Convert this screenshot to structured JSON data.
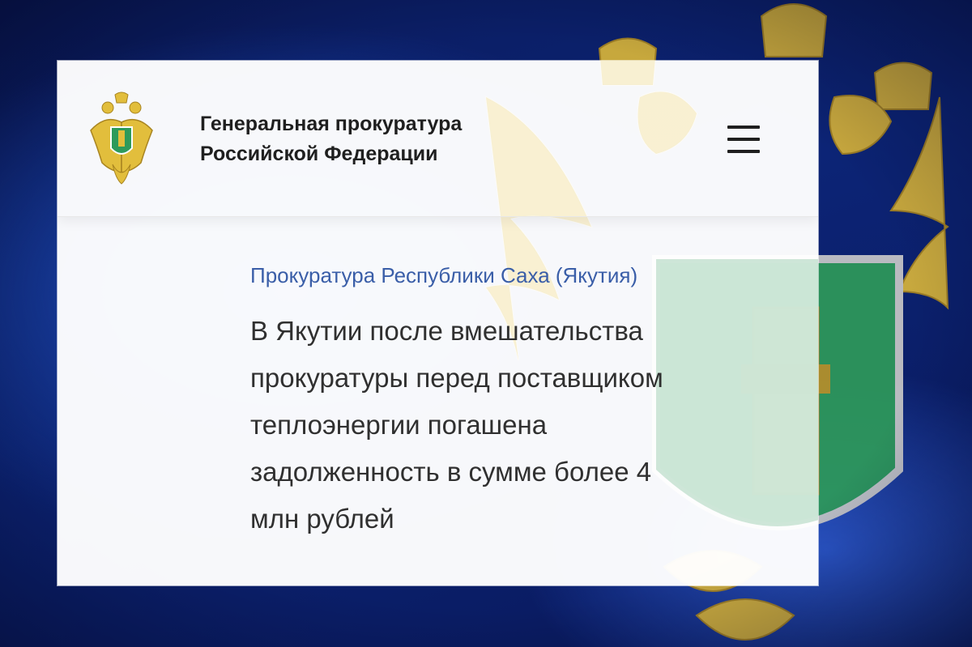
{
  "header": {
    "org_title_line1": "Генеральная прокуратура",
    "org_title_line2": "Российской Федерации",
    "logo_icon": "prosecutor-general-emblem",
    "menu_icon": "hamburger-menu-icon"
  },
  "article": {
    "source": "Прокуратура Республики Саха (Якутия)",
    "headline_lines": [
      "В Якутии после вмешательства",
      "прокуратуры перед поставщиком",
      "теплоэнергии погашена",
      "задолженность в сумме более 4",
      "млн рублей"
    ]
  },
  "colors": {
    "background": "#14358f",
    "card": "#ffffff",
    "link": "#3a5ea8",
    "text": "#303030",
    "emblem_gold": "#e8c84a",
    "shield_green": "#2e9a5a"
  }
}
